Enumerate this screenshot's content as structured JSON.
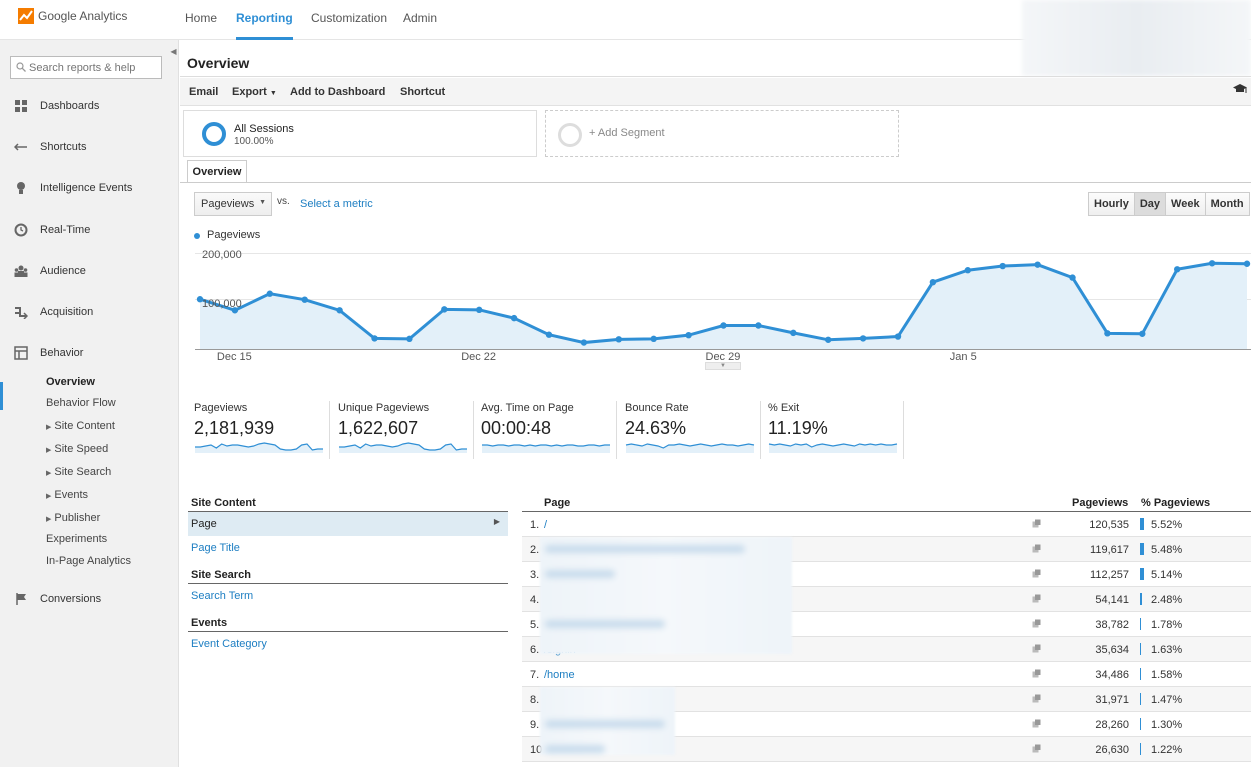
{
  "app": {
    "name": "Google Analytics"
  },
  "topnav": [
    {
      "label": "Home"
    },
    {
      "label": "Reporting"
    },
    {
      "label": "Customization"
    },
    {
      "label": "Admin"
    }
  ],
  "sidebar": {
    "search_placeholder": "Search reports & help",
    "items": [
      {
        "label": "Dashboards"
      },
      {
        "label": "Shortcuts"
      },
      {
        "label": "Intelligence Events"
      },
      {
        "label": "Real-Time"
      },
      {
        "label": "Audience"
      },
      {
        "label": "Acquisition"
      },
      {
        "label": "Behavior"
      },
      {
        "label": "Conversions"
      }
    ],
    "behavior_sub": [
      {
        "label": "Overview"
      },
      {
        "label": "Behavior Flow"
      },
      {
        "label": "Site Content"
      },
      {
        "label": "Site Speed"
      },
      {
        "label": "Site Search"
      },
      {
        "label": "Events"
      },
      {
        "label": "Publisher"
      },
      {
        "label": "Experiments"
      },
      {
        "label": "In-Page Analytics"
      }
    ]
  },
  "page": {
    "title": "Overview",
    "toolbar": {
      "email": "Email",
      "export": "Export",
      "dashboard": "Add to Dashboard",
      "shortcut": "Shortcut"
    },
    "segments": {
      "all_name": "All Sessions",
      "all_pct": "100.00%",
      "add_label": "+ Add Segment"
    },
    "tab": "Overview",
    "metric_select": "Pageviews",
    "vs": "vs.",
    "select_metric": "Select a metric",
    "periods": [
      {
        "label": "Hourly"
      },
      {
        "label": "Day"
      },
      {
        "label": "Week"
      },
      {
        "label": "Month"
      }
    ],
    "active_period": "Day"
  },
  "chart_data": {
    "type": "area",
    "series": [
      {
        "name": "Pageviews",
        "values": [
          108000,
          84000,
          120000,
          107000,
          84000,
          23000,
          22000,
          86000,
          85000,
          67000,
          31000,
          14000,
          21000,
          22000,
          30000,
          51000,
          51000,
          35000,
          20000,
          23000,
          27000,
          145000,
          171000,
          180000,
          183000,
          155000,
          34000,
          33000,
          173000,
          186000,
          185000
        ]
      }
    ],
    "x_ticks": [
      "Dec 15",
      "Dec 22",
      "Dec 29",
      "Jan 5"
    ],
    "y_ticks": [
      "200,000",
      "100,000"
    ],
    "ylim": [
      0,
      200000
    ],
    "grid": true,
    "color": "#2f8fd5",
    "fill": "#e3f0f9"
  },
  "scorecards": [
    {
      "label": "Pageviews",
      "value": "2,181,939"
    },
    {
      "label": "Unique Pageviews",
      "value": "1,622,607"
    },
    {
      "label": "Avg. Time on Page",
      "value": "00:00:48"
    },
    {
      "label": "Bounce Rate",
      "value": "24.63%"
    },
    {
      "label": "% Exit",
      "value": "11.19%"
    }
  ],
  "dimensions": {
    "site_content": {
      "header": "Site Content",
      "active": "Page",
      "link": "Page Title"
    },
    "site_search": {
      "header": "Site Search",
      "link": "Search Term"
    },
    "events": {
      "header": "Events",
      "link": "Event Category"
    }
  },
  "table": {
    "headers": {
      "page": "Page",
      "pageviews": "Pageviews",
      "pct": "% Pageviews"
    },
    "rows": [
      {
        "num": "1.",
        "page": "/",
        "pv": "120,535",
        "pct": "5.52%",
        "share": 5.52
      },
      {
        "num": "2.",
        "page": "",
        "pv": "119,617",
        "pct": "5.48%",
        "share": 5.48
      },
      {
        "num": "3.",
        "page": "",
        "pv": "112,257",
        "pct": "5.14%",
        "share": 5.14
      },
      {
        "num": "4.",
        "page": "",
        "pv": "54,141",
        "pct": "2.48%",
        "share": 2.48
      },
      {
        "num": "5.",
        "page": "",
        "pv": "38,782",
        "pct": "1.78%",
        "share": 1.78
      },
      {
        "num": "6.",
        "page": "/signin",
        "pv": "35,634",
        "pct": "1.63%",
        "share": 1.63
      },
      {
        "num": "7.",
        "page": "/home",
        "pv": "34,486",
        "pct": "1.58%",
        "share": 1.58
      },
      {
        "num": "8.",
        "page": "",
        "pv": "31,971",
        "pct": "1.47%",
        "share": 1.47
      },
      {
        "num": "9.",
        "page": "",
        "pv": "28,260",
        "pct": "1.30%",
        "share": 1.3
      },
      {
        "num": "10.",
        "page": "",
        "pv": "26,630",
        "pct": "1.22%",
        "share": 1.22
      }
    ]
  },
  "colors": {
    "accent": "#2f8fd5",
    "link": "#1d7ec2",
    "selected_row": "#deebf3"
  }
}
